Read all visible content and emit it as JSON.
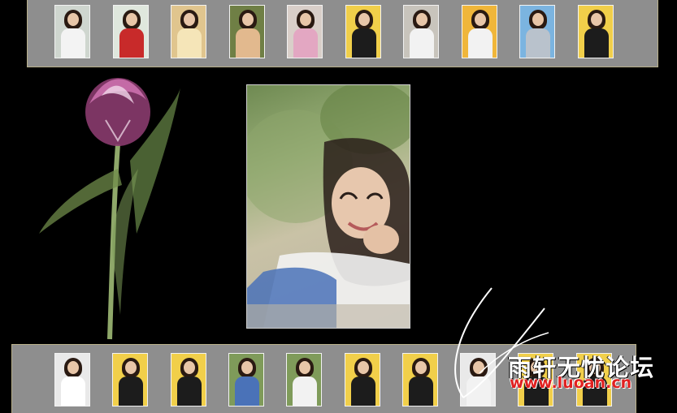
{
  "gallery": {
    "top_thumbnails": [
      {
        "name": "thumb-1",
        "bg": "#cfd6cf",
        "outfit": "#f3f3f3"
      },
      {
        "name": "thumb-2",
        "bg": "#dfe7dd",
        "outfit": "#c82a2a"
      },
      {
        "name": "thumb-3",
        "bg": "#e0c58e",
        "outfit": "#f5e5b8"
      },
      {
        "name": "thumb-4",
        "bg": "#6f7f45",
        "outfit": "#e2b98e"
      },
      {
        "name": "thumb-5",
        "bg": "#d9cfc9",
        "outfit": "#e3a7c2"
      },
      {
        "name": "thumb-6",
        "bg": "#f1cf4a",
        "outfit": "#1c1c1c"
      },
      {
        "name": "thumb-7",
        "bg": "#c8c4bc",
        "outfit": "#f2f2f2"
      },
      {
        "name": "thumb-8",
        "bg": "#f0b63a",
        "outfit": "#f2f2f2"
      },
      {
        "name": "thumb-9",
        "bg": "#7bb4e0",
        "outfit": "#b9c2cc"
      },
      {
        "name": "thumb-10",
        "bg": "#f1cf4a",
        "outfit": "#1c1c1c"
      }
    ],
    "bottom_thumbnails": [
      {
        "name": "thumb-11",
        "bg": "#e9e9e9",
        "outfit": "#ffffff"
      },
      {
        "name": "thumb-12",
        "bg": "#f1cf4a",
        "outfit": "#1c1c1c"
      },
      {
        "name": "thumb-13",
        "bg": "#f1cf4a",
        "outfit": "#1c1c1c"
      },
      {
        "name": "thumb-14",
        "bg": "#7f9b5a",
        "outfit": "#4a72b8"
      },
      {
        "name": "thumb-15",
        "bg": "#7f9b5a",
        "outfit": "#f2f2f2"
      },
      {
        "name": "thumb-16",
        "bg": "#f1cf4a",
        "outfit": "#1c1c1c"
      },
      {
        "name": "thumb-17",
        "bg": "#f1cf4a",
        "outfit": "#1c1c1c"
      },
      {
        "name": "thumb-18",
        "bg": "#e9e9e9",
        "outfit": "#f2f2f2"
      },
      {
        "name": "thumb-19",
        "bg": "#f1cf4a",
        "outfit": "#1c1c1c"
      },
      {
        "name": "thumb-20",
        "bg": "#f1cf4a",
        "outfit": "#1c1c1c"
      }
    ],
    "frame_color": "#8e8e8e",
    "frame_border_color": "#b9b08a"
  },
  "watermark": {
    "text": "雨轩无忧论坛",
    "url": "www.luoan.cn"
  }
}
